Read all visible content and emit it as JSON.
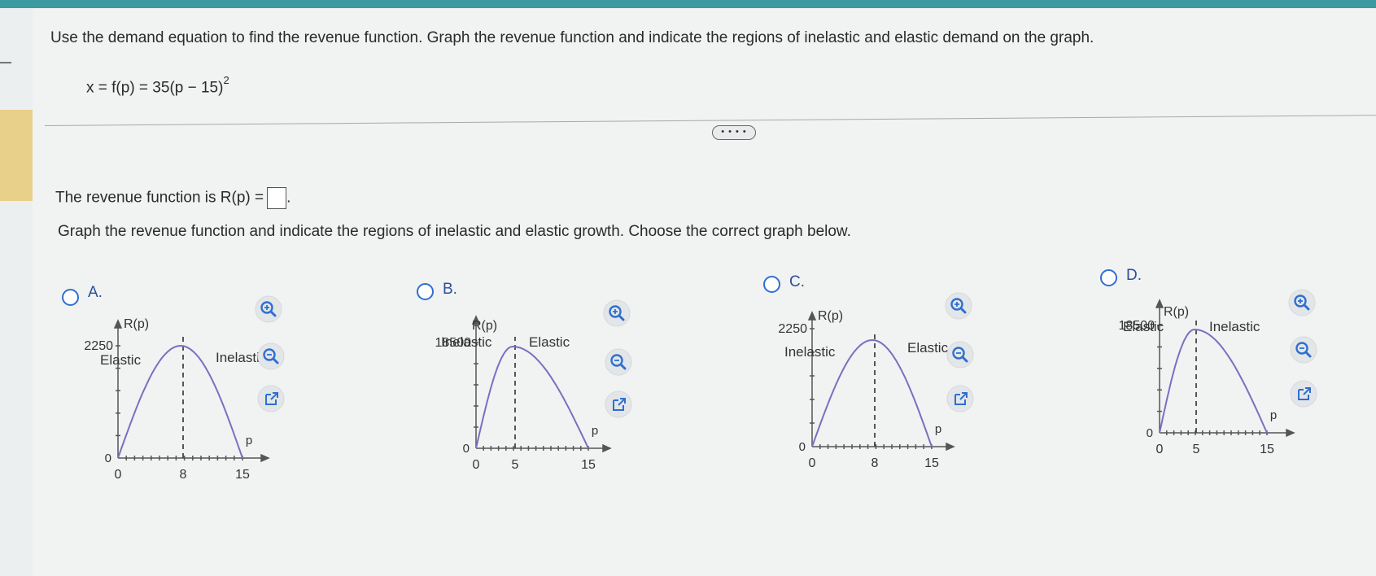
{
  "question": "Use the demand equation to find the revenue function. Graph the revenue function and indicate the regions of inelastic and elastic demand on the graph.",
  "equation": {
    "lhs": "x = f(p) = 35(p − 15)",
    "exponent": "2"
  },
  "revenue": {
    "label": "The revenue function is R(p) =",
    "value": "",
    "trail": "."
  },
  "graph_prompt": "Graph the revenue function and indicate the regions of inelastic and elastic growth. Choose the correct graph below.",
  "more_button": "• • • •",
  "options": [
    {
      "label": "A.",
      "ylabel": "R(p)",
      "ytick": "2250",
      "yzero": "0",
      "xzero": "0",
      "xmid": "8",
      "xend": "15",
      "xlabel": "p",
      "left_region": "Elastic",
      "right_region": "Inelastic"
    },
    {
      "label": "B.",
      "ylabel": "R(p)",
      "ytick": "18500",
      "yzero": "0",
      "xzero": "0",
      "xmid": "5",
      "xend": "15",
      "xlabel": "p",
      "left_region": "Inelastic",
      "right_region": "Elastic"
    },
    {
      "label": "C.",
      "ylabel": "R(p)",
      "ytick": "2250",
      "yzero": "0",
      "xzero": "0",
      "xmid": "8",
      "xend": "15",
      "xlabel": "p",
      "left_region": "Inelastic",
      "right_region": "Elastic"
    },
    {
      "label": "D.",
      "ylabel": "R(p)",
      "ytick": "18500",
      "yzero": "0",
      "xzero": "0",
      "xmid": "5",
      "xend": "15",
      "xlabel": "p",
      "left_region": "Elastic",
      "right_region": "Inelastic"
    }
  ],
  "icons": {
    "zoom_in": "zoom-in-icon",
    "zoom_out": "zoom-out-icon",
    "open": "external-link-icon"
  },
  "colors": {
    "curve": "#7a6fc0",
    "radio": "#2f6fd0",
    "topbar": "#3a9aa0"
  }
}
